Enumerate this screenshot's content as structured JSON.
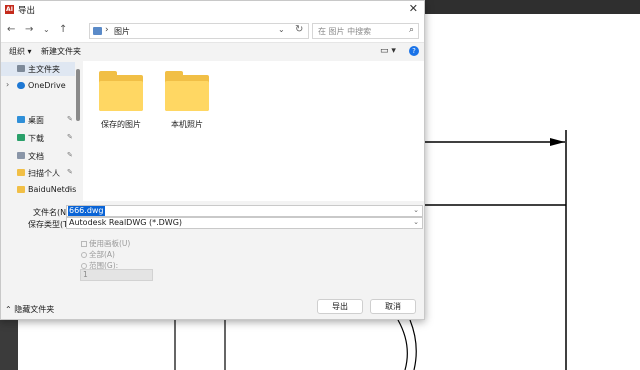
{
  "window": {
    "title": "导出",
    "app_icon_text": "AI",
    "close_glyph": "✕"
  },
  "nav": {
    "back": "←",
    "forward": "→",
    "dropdown": "⌄",
    "up": "↑",
    "breadcrumb_sep": "›",
    "path": "图片",
    "refresh": "↻"
  },
  "search": {
    "placeholder": "在 图片 中搜索",
    "icon": "⌕"
  },
  "toolbar": {
    "organize": "组织 ▾",
    "new_folder": "新建文件夹",
    "view": "▭ ▾",
    "help": "?"
  },
  "sidebar": {
    "items": [
      {
        "label": "主文件夹",
        "icon": "home-icon",
        "selected": true
      },
      {
        "label": "OneDrive",
        "icon": "cloud-icon",
        "expand": "›"
      },
      {
        "label": "桌面",
        "icon": "desktop-icon"
      },
      {
        "label": "下载",
        "icon": "download-icon"
      },
      {
        "label": "文档",
        "icon": "document-icon"
      },
      {
        "label": "扫描个人",
        "icon": "folder-icon"
      },
      {
        "label": "BaiduNetdis",
        "icon": "folder-icon"
      }
    ],
    "pin_glyph": "📌"
  },
  "folders": [
    {
      "label": "保存的图片",
      "icon": "folder-icon"
    },
    {
      "label": "本机照片",
      "icon": "folder-icon"
    }
  ],
  "form": {
    "filename_label": "文件名(N):",
    "filename_value": "666.dwg",
    "filetype_label": "保存类型(T):",
    "filetype_value": "Autodesk RealDWG (*.DWG)",
    "drop_arrow": "⌄"
  },
  "options": {
    "use_canvas": "使用画板(U)",
    "all": "全部(A)",
    "range": "范围(G):",
    "range_value": "1"
  },
  "footer": {
    "hide_folders": "隐藏文件夹",
    "toggle_glyph": "⌃",
    "export": "导出",
    "cancel": "取消"
  }
}
